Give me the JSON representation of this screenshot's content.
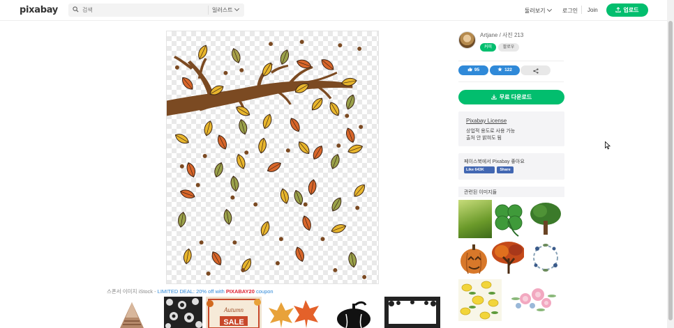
{
  "header": {
    "logo": "pixabay",
    "search_placeholder": "검색",
    "search_filter": "일러스트",
    "browse_label": "둘러보기",
    "login_label": "로그인",
    "join_label": "Join",
    "upload_label": "업로드"
  },
  "sponsor": {
    "prefix": "스폰서 이미지 iStock - ",
    "deal": "LIMITED DEAL: 20% off with ",
    "code": "PIXABAY20",
    "suffix": " coupon"
  },
  "author": {
    "name_line": "Artjane / 사진 213",
    "follow_label": "커피",
    "follower_label": "팔로우"
  },
  "stats": {
    "likes": "95",
    "favorites": "122"
  },
  "download": {
    "label": "무료 다운로드"
  },
  "license": {
    "title": "Pixabay License",
    "line1": "상업적 용도로 사용 가능",
    "line2": "출처 안 밝혀도 됨"
  },
  "facebook": {
    "text": "페이스북에서 Pixabay 좋아요",
    "like_label": "Like 643K",
    "share_label": "Share"
  },
  "related": {
    "title": "관련된 이미지들"
  },
  "colors": {
    "accent_green": "#02be6e",
    "stat_blue": "#2f89d8",
    "facebook_blue": "#4267b2"
  }
}
